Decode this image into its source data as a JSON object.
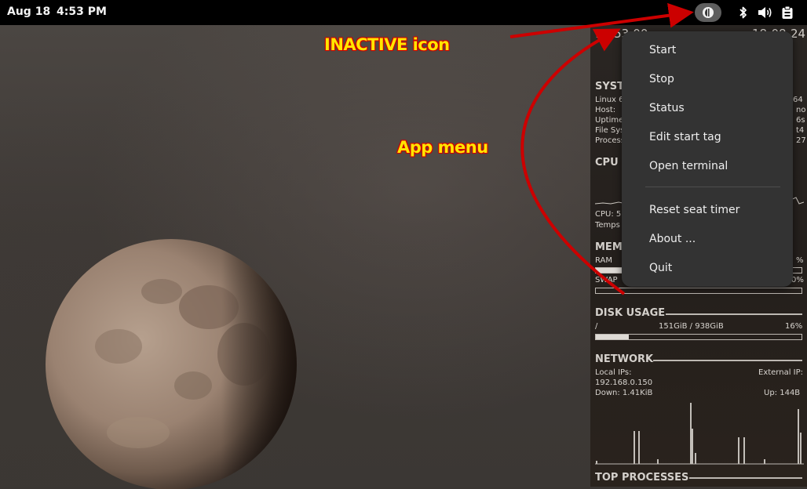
{
  "topbar": {
    "date": "Aug 18",
    "time": "4:53 PM",
    "app_indicator_icon": "app-indicator-icon",
    "tray_icons": [
      "bluetooth-icon",
      "volume-icon",
      "clipboard-icon"
    ]
  },
  "annotations": {
    "inactive_icon": "INACTIVE icon",
    "app_menu": "App menu",
    "arrow_color": "#cc0000",
    "text_color": "#ffe600"
  },
  "menu": {
    "items": [
      {
        "label": "Start"
      },
      {
        "label": "Stop"
      },
      {
        "label": "Status"
      },
      {
        "label": "Edit start tag"
      },
      {
        "label": "Open terminal"
      },
      {
        "label": "Reset seat timer"
      },
      {
        "label": "About ..."
      },
      {
        "label": "Quit"
      }
    ]
  },
  "conky": {
    "clock_left": "16:53:00",
    "clock_right": "18-08-24",
    "system": {
      "heading": "SYST",
      "rows_left": [
        "Linux 6",
        "Host:",
        "Uptime",
        "File Sys",
        "Process"
      ],
      "rows_right": [
        "64",
        "no",
        "6s",
        "t4",
        "27"
      ]
    },
    "cpu": {
      "heading": "CPU",
      "line1": "CPU: 5",
      "line2": "Temps"
    },
    "memory": {
      "heading": "MEMO",
      "ram_label": "RAM",
      "ram_pct": "%",
      "swap_label": "SWAP",
      "swap_pct": "0%"
    },
    "disk": {
      "heading": "DISK USAGE",
      "mount": "/",
      "usage": "151GiB / 938GiB",
      "pct": "16%",
      "fill_fraction": 0.16
    },
    "network": {
      "heading": "NETWORK",
      "local_label": "Local IPs:",
      "external_label": "External IP:",
      "local_ip": "192.168.0.150",
      "down": "Down: 1.41KiB",
      "up": "Up: 144B"
    },
    "top": {
      "heading": "TOP PROCESSES"
    }
  }
}
